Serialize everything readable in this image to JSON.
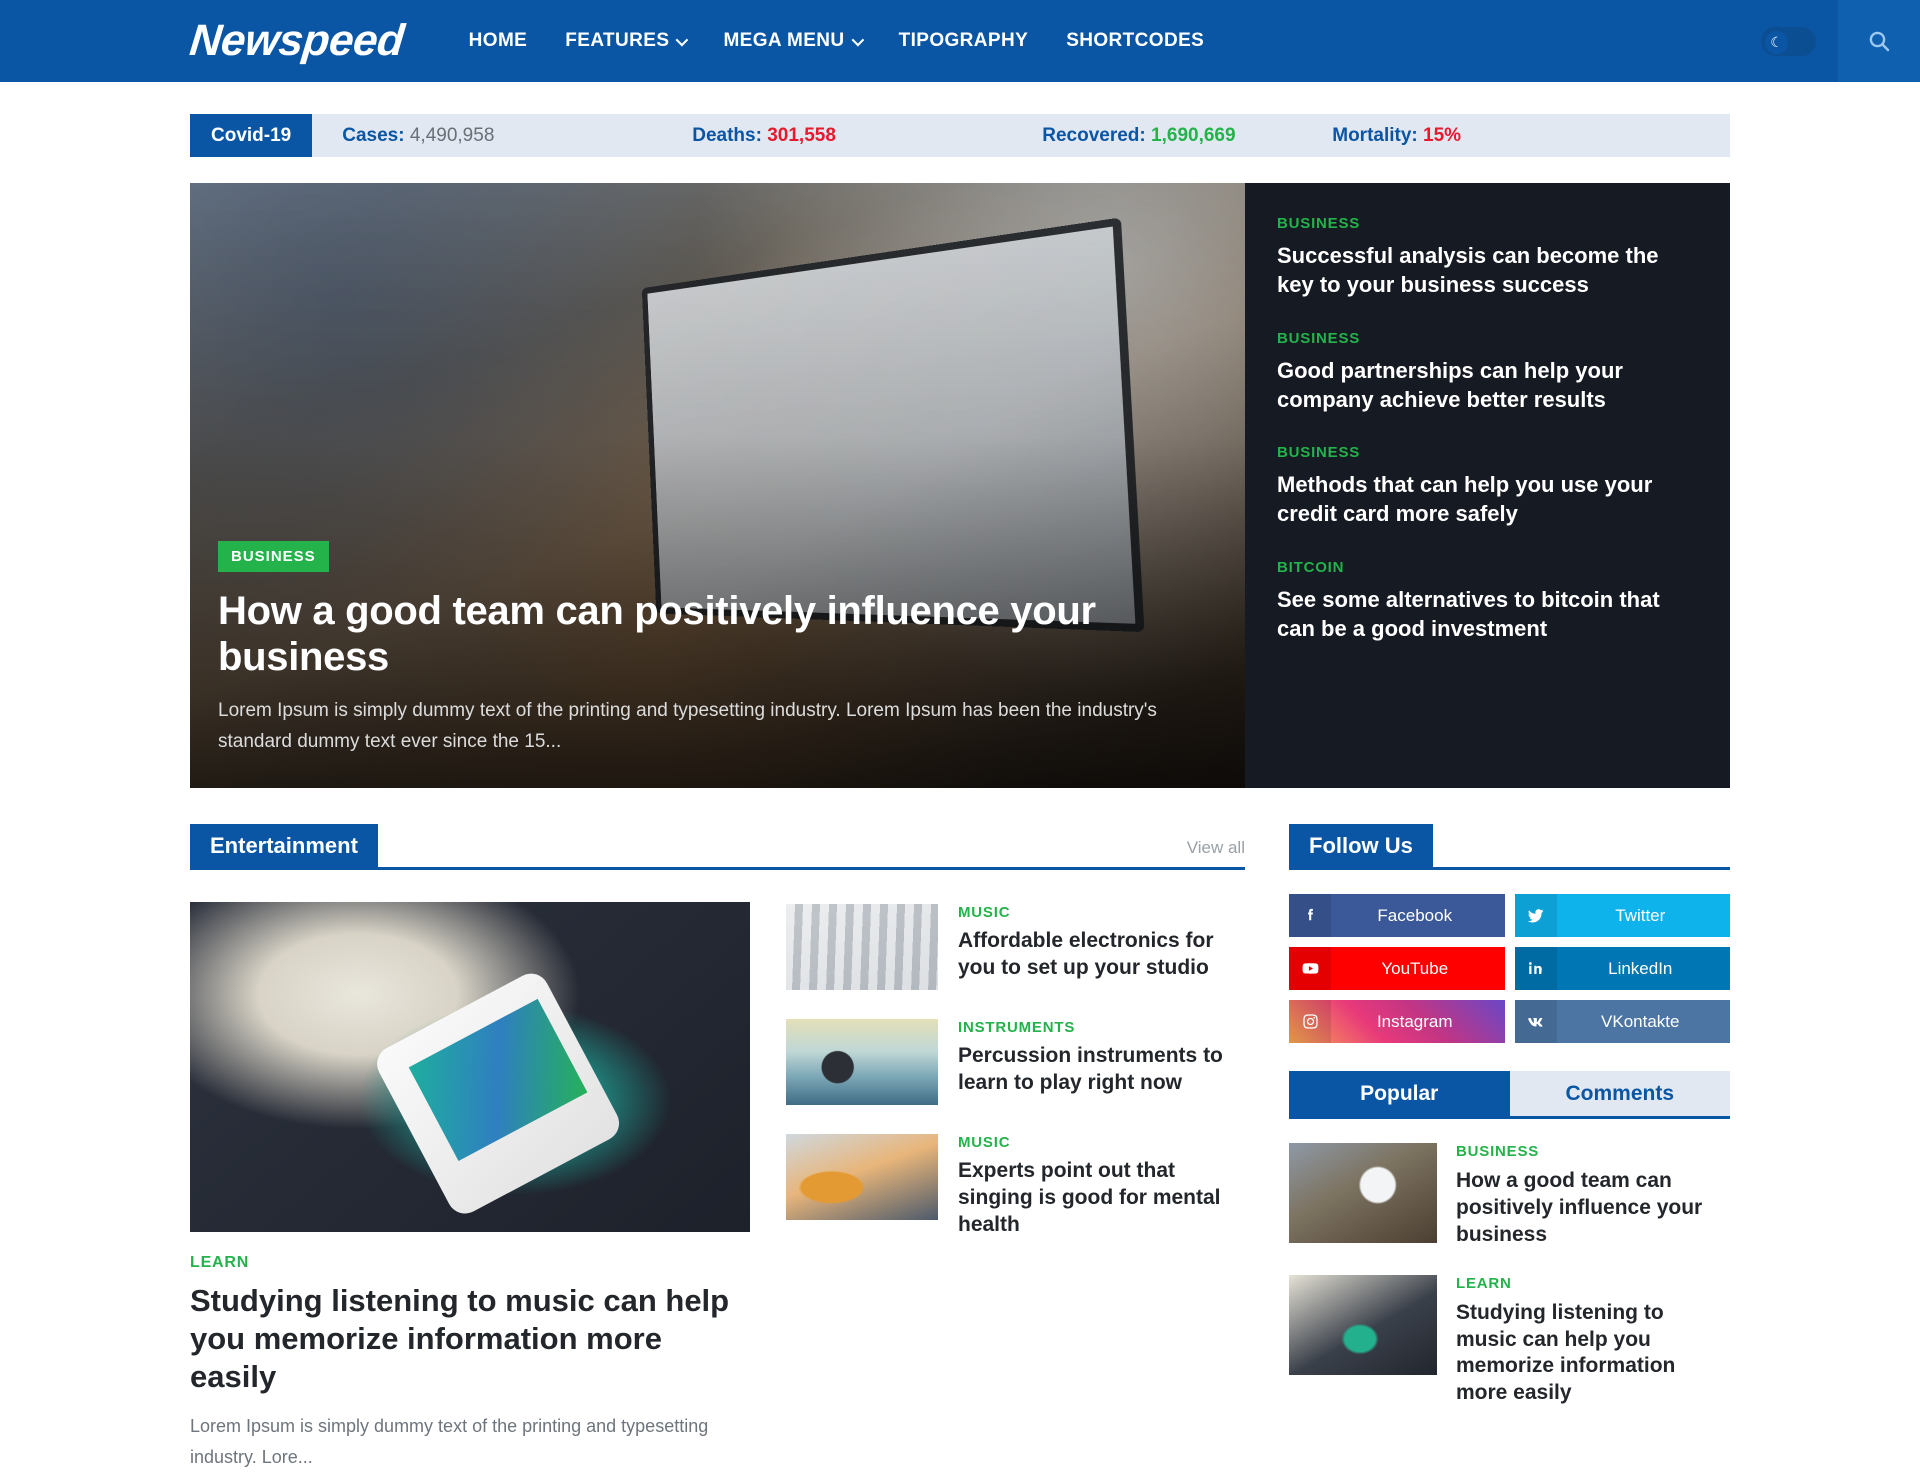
{
  "brand": {
    "logo": "Newspeed",
    "accent": "#0a56a5",
    "green": "#24b24b",
    "red": "#e8192c"
  },
  "nav": {
    "items": [
      {
        "label": "HOME",
        "has_caret": false
      },
      {
        "label": "FEATURES",
        "has_caret": true
      },
      {
        "label": "MEGA MENU",
        "has_caret": true
      },
      {
        "label": "TIPOGRAPHY",
        "has_caret": false
      },
      {
        "label": "SHORTCODES",
        "has_caret": false
      }
    ],
    "dark_mode_icon": "moon-icon",
    "search_icon": "search-icon"
  },
  "covid": {
    "tag": "Covid-19",
    "stats": [
      {
        "label": "Cases:",
        "value": "4,490,958",
        "tone": "grey"
      },
      {
        "label": "Deaths:",
        "value": "301,558",
        "tone": "red"
      },
      {
        "label": "Recovered:",
        "value": "1,690,669",
        "tone": "green"
      },
      {
        "label": "Mortality:",
        "value": "15%",
        "tone": "red"
      }
    ]
  },
  "hero": {
    "category": "BUSINESS",
    "title": "How a good team can positively influence your business",
    "excerpt": "Lorem Ipsum is simply dummy text of the printing and typesetting industry. Lorem Ipsum has been the industry's standard dummy text ever since the 15...",
    "side_items": [
      {
        "category": "BUSINESS",
        "title": "Successful analysis can become the key to your business success"
      },
      {
        "category": "BUSINESS",
        "title": "Good partnerships can help your company achieve better results"
      },
      {
        "category": "BUSINESS",
        "title": "Methods that can help you use your credit card more safely"
      },
      {
        "category": "BITCOIN",
        "title": "See some alternatives to bitcoin that can be a good investment"
      }
    ]
  },
  "entertainment": {
    "section_title": "Entertainment",
    "view_all": "View all",
    "feature": {
      "category": "LEARN",
      "title": "Studying listening to music can help you memorize information more easily",
      "excerpt": "Lorem Ipsum is simply dummy text of the printing and typesetting industry. Lore..."
    },
    "list": [
      {
        "category": "MUSIC",
        "title": "Affordable electronics for you to set up your studio",
        "thumb": "mixer-photo"
      },
      {
        "category": "INSTRUMENTS",
        "title": "Percussion instruments to learn to play right now",
        "thumb": "drummer-photo"
      },
      {
        "category": "MUSIC",
        "title": "Experts point out that singing is good for mental health",
        "thumb": "guitar-photo"
      }
    ]
  },
  "sidebar": {
    "follow": {
      "title": "Follow Us",
      "networks": [
        {
          "label": "Facebook",
          "icon": "facebook-icon",
          "color": "#3b5998"
        },
        {
          "label": "Twitter",
          "icon": "twitter-icon",
          "color": "#0fb3ec"
        },
        {
          "label": "YouTube",
          "icon": "youtube-icon",
          "color": "#fe0000"
        },
        {
          "label": "LinkedIn",
          "icon": "linkedin-icon",
          "color": "#0077b5"
        },
        {
          "label": "Instagram",
          "icon": "instagram-icon",
          "color": "#c13584"
        },
        {
          "label": "VKontakte",
          "icon": "vkontakte-icon",
          "color": "#4c75a3"
        }
      ]
    },
    "tabs": [
      {
        "label": "Popular",
        "active": true
      },
      {
        "label": "Comments",
        "active": false
      }
    ],
    "popular": [
      {
        "category": "BUSINESS",
        "title": "How a good team can positively influence your business",
        "thumb": "team-photo"
      },
      {
        "category": "LEARN",
        "title": "Studying listening to music can help you memorize information more easily",
        "thumb": "music-photo"
      }
    ]
  }
}
